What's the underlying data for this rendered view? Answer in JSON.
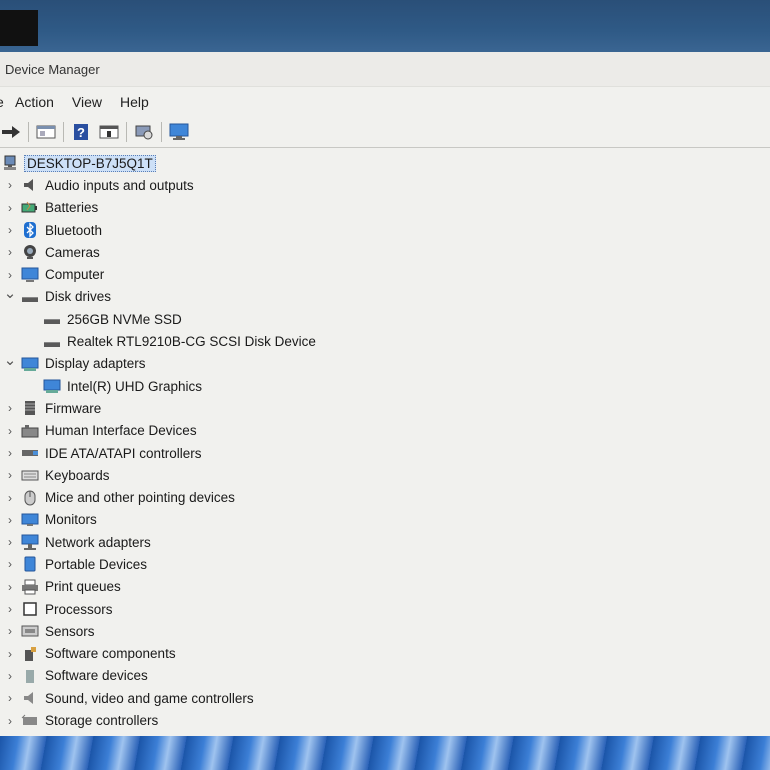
{
  "window": {
    "title": "Device Manager"
  },
  "menu": {
    "file_partial": "e",
    "action": "Action",
    "view": "View",
    "help": "Help"
  },
  "toolbar": [
    "forward-arrow-icon",
    "properties-icon",
    "help-icon",
    "update-driver-icon",
    "scan-hardware-icon",
    "monitor-icon"
  ],
  "tree": {
    "root": "DESKTOP-B7J5Q1T",
    "items": [
      {
        "label": "Audio inputs and outputs",
        "expanded": false,
        "icon": "speaker-icon"
      },
      {
        "label": "Batteries",
        "expanded": false,
        "icon": "battery-icon"
      },
      {
        "label": "Bluetooth",
        "expanded": false,
        "icon": "bluetooth-icon"
      },
      {
        "label": "Cameras",
        "expanded": false,
        "icon": "camera-icon"
      },
      {
        "label": "Computer",
        "expanded": false,
        "icon": "computer-icon"
      },
      {
        "label": "Disk drives",
        "expanded": true,
        "icon": "disk-icon",
        "children": [
          {
            "label": "256GB NVMe SSD",
            "icon": "disk-icon"
          },
          {
            "label": "Realtek RTL9210B-CG SCSI Disk Device",
            "icon": "disk-icon"
          }
        ]
      },
      {
        "label": "Display adapters",
        "expanded": true,
        "icon": "display-icon",
        "children": [
          {
            "label": "Intel(R) UHD Graphics",
            "icon": "display-icon"
          }
        ]
      },
      {
        "label": "Firmware",
        "expanded": false,
        "icon": "firmware-icon"
      },
      {
        "label": "Human Interface Devices",
        "expanded": false,
        "icon": "hid-icon"
      },
      {
        "label": "IDE ATA/ATAPI controllers",
        "expanded": false,
        "icon": "ide-icon"
      },
      {
        "label": "Keyboards",
        "expanded": false,
        "icon": "keyboard-icon"
      },
      {
        "label": "Mice and other pointing devices",
        "expanded": false,
        "icon": "mouse-icon"
      },
      {
        "label": "Monitors",
        "expanded": false,
        "icon": "monitor-icon"
      },
      {
        "label": "Network adapters",
        "expanded": false,
        "icon": "network-icon"
      },
      {
        "label": "Portable Devices",
        "expanded": false,
        "icon": "portable-icon"
      },
      {
        "label": "Print queues",
        "expanded": false,
        "icon": "printer-icon"
      },
      {
        "label": "Processors",
        "expanded": false,
        "icon": "processor-icon"
      },
      {
        "label": "Sensors",
        "expanded": false,
        "icon": "sensor-icon"
      },
      {
        "label": "Software components",
        "expanded": false,
        "icon": "software-component-icon"
      },
      {
        "label": "Software devices",
        "expanded": false,
        "icon": "software-device-icon"
      },
      {
        "label": "Sound, video and game controllers",
        "expanded": false,
        "icon": "sound-icon"
      },
      {
        "label": "Storage controllers",
        "expanded": false,
        "icon": "storage-icon"
      }
    ]
  }
}
